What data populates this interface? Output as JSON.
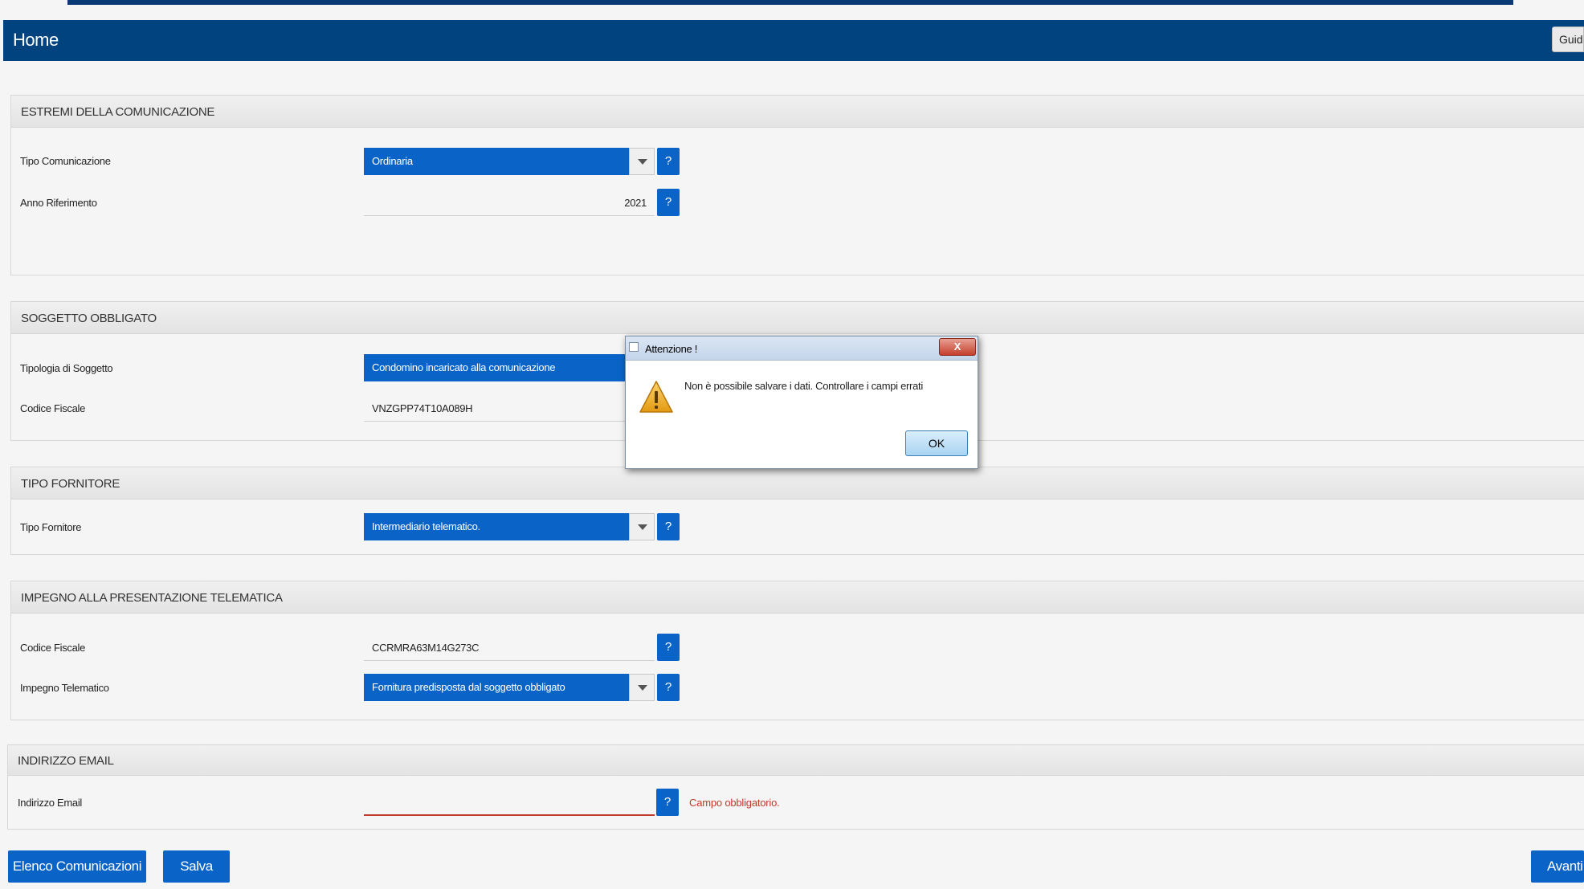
{
  "header": {
    "title": "Home",
    "guide_label": "Guida"
  },
  "sections": {
    "estremi": {
      "title": "ESTREMI DELLA COMUNICAZIONE",
      "tipo_comunicazione": {
        "label": "Tipo Comunicazione",
        "value": "Ordinaria"
      },
      "anno_riferimento": {
        "label": "Anno Riferimento",
        "value": "2021"
      }
    },
    "soggetto": {
      "title": "SOGGETTO OBBLIGATO",
      "tipologia": {
        "label": "Tipologia di Soggetto",
        "value": "Condomino incaricato alla comunicazione"
      },
      "codice_fiscale": {
        "label": "Codice Fiscale",
        "value": "VNZGPP74T10A089H"
      }
    },
    "fornitore": {
      "title": "TIPO FORNITORE",
      "tipo_fornitore": {
        "label": "Tipo Fornitore",
        "value": "Intermediario telematico."
      }
    },
    "impegno": {
      "title": "IMPEGNO ALLA PRESENTAZIONE TELEMATICA",
      "codice_fiscale": {
        "label": "Codice Fiscale",
        "value": "CCRMRA63M14G273C"
      },
      "impegno_telematico": {
        "label": "Impegno Telematico",
        "value": "Fornitura predisposta dal soggetto obbligato"
      }
    },
    "email": {
      "title": "INDIRIZZO EMAIL",
      "indirizzo": {
        "label": "Indirizzo Email",
        "value": "",
        "error": "Campo obbligatorio."
      }
    }
  },
  "help_label": "?",
  "footer": {
    "elenco_label": "Elenco Comunicazioni",
    "salva_label": "Salva",
    "avanti_label": "Avanti"
  },
  "dialog": {
    "title": "Attenzione !",
    "close_label": "X",
    "message": "Non è possibile salvare i dati. Controllare i campi errati",
    "ok_label": "OK"
  },
  "colors": {
    "header": "#00437e",
    "accent": "#0a64c8",
    "error": "#c0392b"
  }
}
